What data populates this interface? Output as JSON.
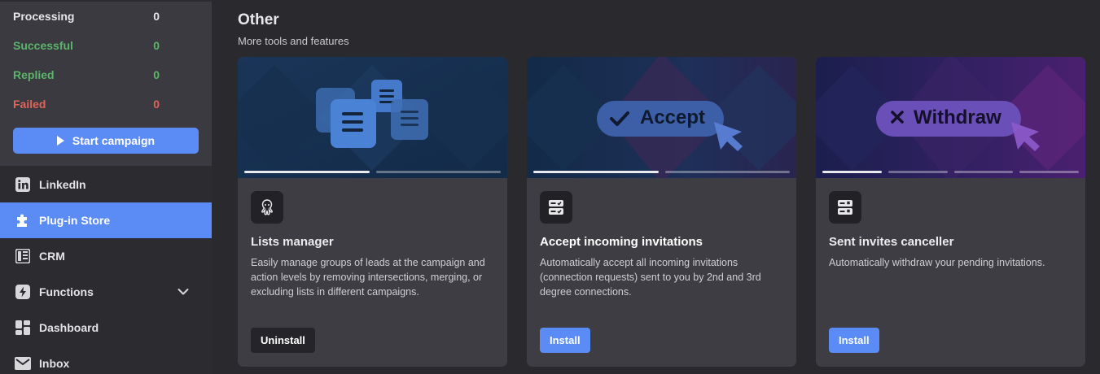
{
  "stats": [
    {
      "label": "Processing",
      "value": "0"
    },
    {
      "label": "Successful",
      "value": "0"
    },
    {
      "label": "Replied",
      "value": "0"
    },
    {
      "label": "Failed",
      "value": "0"
    }
  ],
  "start_campaign_label": "Start campaign",
  "nav": [
    {
      "label": "LinkedIn",
      "icon": "linkedin-icon"
    },
    {
      "label": "Plug-in Store",
      "icon": "puzzle-icon"
    },
    {
      "label": "CRM",
      "icon": "crm-icon"
    },
    {
      "label": "Functions",
      "icon": "lightning-icon"
    },
    {
      "label": "Dashboard",
      "icon": "dashboard-icon"
    },
    {
      "label": "Inbox",
      "icon": "mail-icon"
    }
  ],
  "section": {
    "title": "Other",
    "subtitle": "More tools and features"
  },
  "cards": [
    {
      "title": "Lists manager",
      "description": "Easily manage groups of leads at the campaign and action levels by removing intersections, merging, or excluding lists in different campaigns.",
      "button": "Uninstall",
      "icon": "octopus-icon",
      "progress_active": 1,
      "progress_total": 2
    },
    {
      "title": "Accept incoming invitations",
      "description": "Automatically accept all incoming invitations (connection requests) sent to you by 2nd and 3rd degree connections.",
      "button": "Install",
      "icon": "accept-list-icon",
      "banner_text": "Accept",
      "progress_active": 1,
      "progress_total": 2
    },
    {
      "title": "Sent invites canceller",
      "description": "Automatically withdraw your pending invitations.",
      "button": "Install",
      "icon": "cancel-list-icon",
      "banner_text": "Withdraw",
      "progress_active": 1,
      "progress_total": 4
    }
  ],
  "colors": {
    "accent": "#5b8cf5",
    "success": "#5bb56a",
    "failure": "#e0645a"
  }
}
